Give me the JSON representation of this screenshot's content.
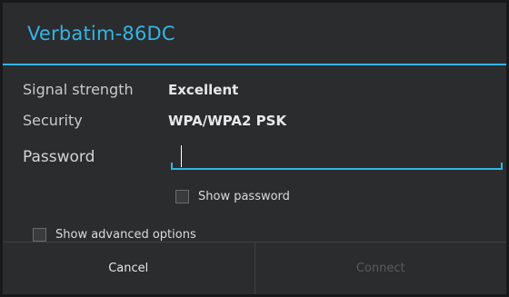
{
  "dialog": {
    "title": "Verbatim-86DC"
  },
  "info": {
    "signal_label": "Signal strength",
    "signal_value": "Excellent",
    "security_label": "Security",
    "security_value": "WPA/WPA2 PSK"
  },
  "password": {
    "label": "Password",
    "value": ""
  },
  "options": {
    "show_password_label": "Show password",
    "show_password_checked": false,
    "show_advanced_label": "Show advanced options",
    "show_advanced_checked": false
  },
  "buttons": {
    "cancel_label": "Cancel",
    "connect_label": "Connect"
  },
  "colors": {
    "accent": "#33b5e5",
    "background": "#2b2c2e",
    "disabled_text": "#5a5b5d"
  }
}
